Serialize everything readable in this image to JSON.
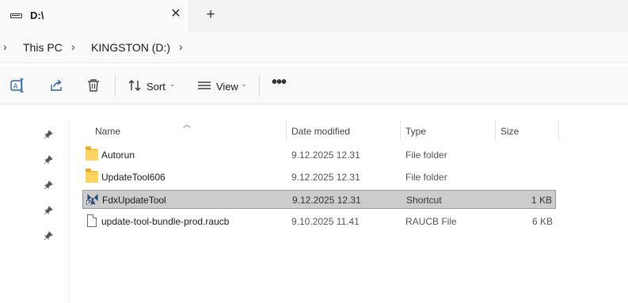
{
  "tab": {
    "title": "D:\\",
    "close_glyph": "✕",
    "new_tab_glyph": "+",
    "icon": "drive-icon"
  },
  "address": {
    "crumbs": [
      "This PC",
      "KINGSTON (D:)"
    ]
  },
  "commands": {
    "rename_icon": "rename-icon",
    "share_icon": "share-icon",
    "delete_icon": "delete-icon",
    "sort_label": "Sort",
    "view_label": "View",
    "more_glyph": "•••"
  },
  "columns": {
    "name": "Name",
    "date_modified": "Date modified",
    "type": "Type",
    "size": "Size"
  },
  "files": [
    {
      "name": "Autorun",
      "date": "9.12.2025 12.31",
      "type": "File folder",
      "size": "",
      "icon": "folder-icon"
    },
    {
      "name": "UpdateTool606",
      "date": "9.12.2025 12.31",
      "type": "File folder",
      "size": "",
      "icon": "folder-icon"
    },
    {
      "name": "FdxUpdateTool",
      "date": "9.12.2025 12.31",
      "type": "Shortcut",
      "size": "1 KB",
      "icon": "app-shortcut-icon",
      "selected": true
    },
    {
      "name": "update-tool-bundle-prod.raucb",
      "date": "9.10.2025 11.41",
      "type": "RAUCB File",
      "size": "6 KB",
      "icon": "file-icon"
    }
  ],
  "colors": {
    "selected_row_bg": "#cccccc",
    "folder_yellow": "#ffd45f",
    "app_icon_blue": "#2b4a7a"
  }
}
